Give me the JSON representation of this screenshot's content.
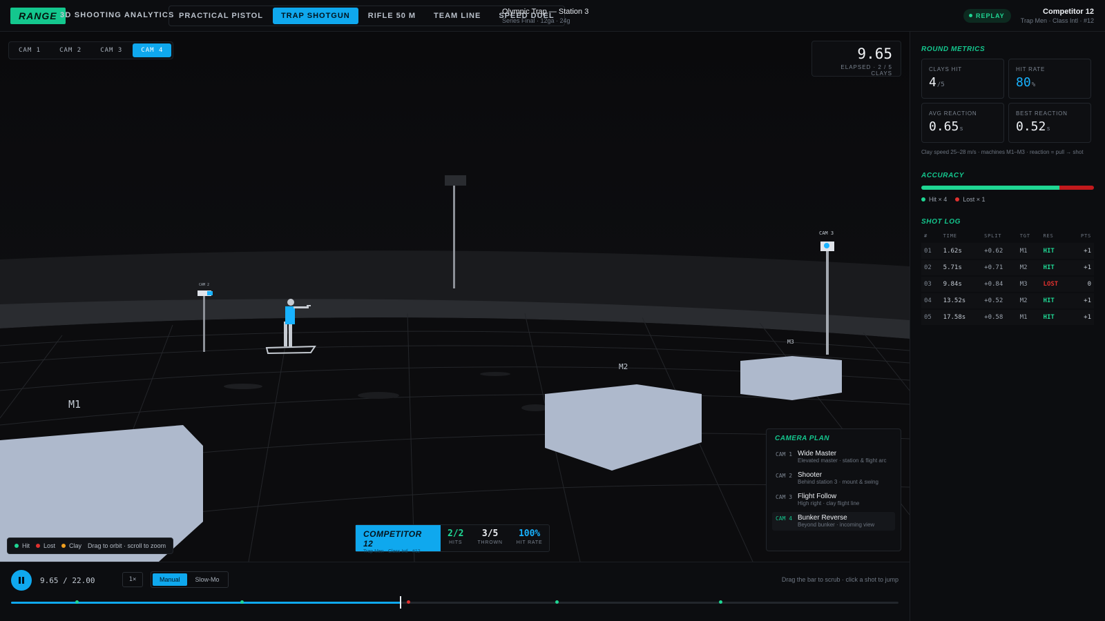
{
  "header": {
    "brand": "RANGE",
    "brand_sub": "3D SHOOTING ANALYTICS",
    "tabs": [
      {
        "label": "PRACTICAL PISTOL",
        "active": false
      },
      {
        "label": "TRAP SHOTGUN",
        "active": true
      },
      {
        "label": "RIFLE 50 M",
        "active": false
      },
      {
        "label": "TEAM LINE",
        "active": false
      },
      {
        "label": "SPEED DUEL",
        "active": false
      }
    ],
    "event_title": "Olympic Trap — Station 3",
    "event_sub": "Series Final · 12ga · 24g",
    "replay_label": "REPLAY",
    "competitor_name": "Competitor 12",
    "competitor_sub": "Trap Men · Class Intl · #12"
  },
  "viewport": {
    "cams": [
      {
        "label": "CAM 1",
        "active": false
      },
      {
        "label": "CAM 2",
        "active": false
      },
      {
        "label": "CAM 3",
        "active": false
      },
      {
        "label": "CAM 4",
        "active": true
      }
    ],
    "timer_value": "9.65",
    "timer_sub": "ELAPSED · 2 / 5 CLAYS",
    "scene_labels": {
      "m1": "M1",
      "m2": "M2",
      "m3": "M3",
      "cam2": "CAM 2",
      "cam3": "CAM 3"
    },
    "camera_plan": {
      "title": "CAMERA PLAN",
      "items": [
        {
          "num": "CAM 1",
          "name": "Wide Master",
          "desc": "Elevated master · station & flight arc",
          "active": false
        },
        {
          "num": "CAM 2",
          "name": "Shooter",
          "desc": "Behind station 3 · mount & swing",
          "active": false
        },
        {
          "num": "CAM 3",
          "name": "Flight Follow",
          "desc": "High right · clay flight line",
          "active": false
        },
        {
          "num": "CAM 4",
          "name": "Bunker Reverse",
          "desc": "Beyond bunker · incoming view",
          "active": true
        }
      ]
    },
    "legend": {
      "hit": "Hit",
      "lost": "Lost",
      "clay": "Clay",
      "hint": "Drag to orbit · scroll to zoom"
    },
    "score_card": {
      "name": "COMPETITOR 12",
      "sub": "Trap Men · Class Intl · #12",
      "hits_value": "2/2",
      "hits_label": "HITS",
      "thrown_value": "3/5",
      "thrown_label": "THROWN",
      "rate_value": "100%",
      "rate_label": "HIT RATE"
    }
  },
  "controls": {
    "time": "9.65 / 22.00",
    "speed": "1×",
    "modes": [
      {
        "label": "Manual",
        "active": true
      },
      {
        "label": "Slow-Mo",
        "active": false
      }
    ],
    "hint": "Drag the bar to scrub · click a shot to jump",
    "duration": 22.0,
    "current": 9.65,
    "markers": [
      {
        "t": 1.62,
        "result": "hit"
      },
      {
        "t": 5.71,
        "result": "hit"
      },
      {
        "t": 9.84,
        "result": "lost"
      },
      {
        "t": 13.52,
        "result": "hit"
      },
      {
        "t": 17.58,
        "result": "hit"
      }
    ]
  },
  "panel": {
    "round_title": "ROUND METRICS",
    "metrics": [
      {
        "label": "CLAYS HIT",
        "value": "4",
        "unit": "/5",
        "accent": false
      },
      {
        "label": "HIT RATE",
        "value": "80",
        "unit": "%",
        "accent": true
      },
      {
        "label": "AVG REACTION",
        "value": "0.65",
        "unit": "s",
        "accent": false
      },
      {
        "label": "BEST REACTION",
        "value": "0.52",
        "unit": "s",
        "accent": false
      }
    ],
    "note": "Clay speed 25–28 m/s · machines M1–M3 · reaction = pull → shot",
    "accuracy_title": "ACCURACY",
    "accuracy": {
      "hit": 4,
      "lost": 1,
      "hit_label": "Hit × 4",
      "lost_label": "Lost × 1"
    },
    "log_title": "SHOT LOG",
    "log_headers": [
      "#",
      "TIME",
      "SPLIT",
      "TGT",
      "RES",
      "PTS"
    ],
    "log_rows": [
      {
        "n": "01",
        "time": "1.62s",
        "split": "+0.62",
        "tgt": "M1",
        "res": "HIT",
        "pts": "+1"
      },
      {
        "n": "02",
        "time": "5.71s",
        "split": "+0.71",
        "tgt": "M2",
        "res": "HIT",
        "pts": "+1"
      },
      {
        "n": "03",
        "time": "9.84s",
        "split": "+0.84",
        "tgt": "M3",
        "res": "LOST",
        "pts": "0"
      },
      {
        "n": "04",
        "time": "13.52s",
        "split": "+0.52",
        "tgt": "M2",
        "res": "HIT",
        "pts": "+1"
      },
      {
        "n": "05",
        "time": "17.58s",
        "split": "+0.58",
        "tgt": "M1",
        "res": "HIT",
        "pts": "+1"
      }
    ]
  },
  "colors": {
    "accent": "#0fa8ee",
    "green": "#14c78e",
    "hit": "#1fd693",
    "lost": "#e0312f",
    "clay": "#f0a020"
  }
}
